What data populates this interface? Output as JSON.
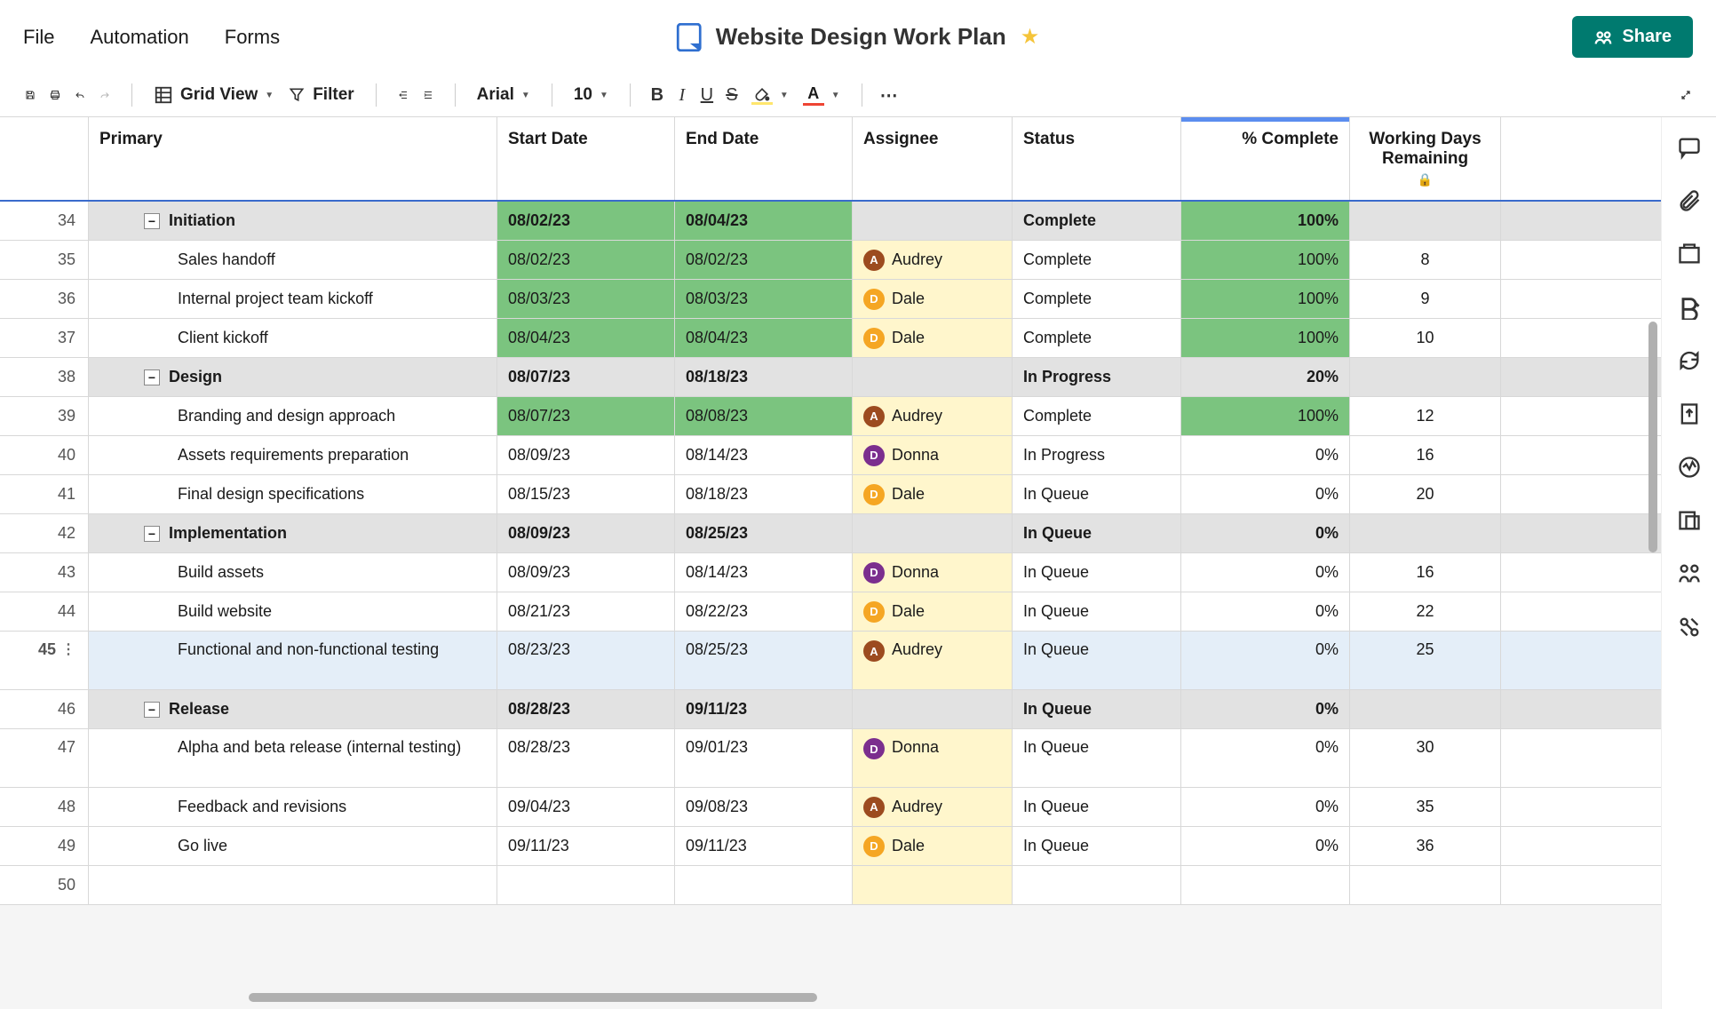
{
  "menu": {
    "file": "File",
    "automation": "Automation",
    "forms": "Forms"
  },
  "title": "Website Design Work Plan",
  "share_label": "Share",
  "toolbar": {
    "grid_view": "Grid View",
    "filter": "Filter",
    "font": "Arial",
    "font_size": "10"
  },
  "columns": {
    "primary": "Primary",
    "start": "Start Date",
    "end": "End Date",
    "assignee": "Assignee",
    "status": "Status",
    "percent": "% Complete",
    "days": "Working Days Remaining"
  },
  "assignees": {
    "audrey": {
      "initial": "A",
      "name": "Audrey",
      "color": "av-a"
    },
    "dale": {
      "initial": "D",
      "name": "Dale",
      "color": "av-d-orange"
    },
    "donna": {
      "initial": "D",
      "name": "Donna",
      "color": "av-d-purple"
    }
  },
  "rows": [
    {
      "num": "34",
      "type": "parent",
      "primary": "Initiation",
      "start": "08/02/23",
      "end": "08/04/23",
      "assignee": null,
      "status": "Complete",
      "percent": "100%",
      "days": "",
      "start_bg": "green",
      "end_bg": "green",
      "percent_bg": "green"
    },
    {
      "num": "35",
      "type": "child",
      "primary": "Sales handoff",
      "start": "08/02/23",
      "end": "08/02/23",
      "assignee": "audrey",
      "status": "Complete",
      "percent": "100%",
      "days": "8",
      "start_bg": "green",
      "end_bg": "green",
      "percent_bg": "green",
      "assignee_bg": "yellow"
    },
    {
      "num": "36",
      "type": "child",
      "primary": "Internal project team kickoff",
      "start": "08/03/23",
      "end": "08/03/23",
      "assignee": "dale",
      "status": "Complete",
      "percent": "100%",
      "days": "9",
      "start_bg": "green",
      "end_bg": "green",
      "percent_bg": "green",
      "assignee_bg": "yellow"
    },
    {
      "num": "37",
      "type": "child",
      "primary": "Client kickoff",
      "start": "08/04/23",
      "end": "08/04/23",
      "assignee": "dale",
      "status": "Complete",
      "percent": "100%",
      "days": "10",
      "start_bg": "green",
      "end_bg": "green",
      "percent_bg": "green",
      "assignee_bg": "yellow"
    },
    {
      "num": "38",
      "type": "parent",
      "primary": "Design",
      "start": "08/07/23",
      "end": "08/18/23",
      "assignee": null,
      "status": "In Progress",
      "percent": "20%",
      "days": ""
    },
    {
      "num": "39",
      "type": "child",
      "primary": "Branding and design approach",
      "start": "08/07/23",
      "end": "08/08/23",
      "assignee": "audrey",
      "status": "Complete",
      "percent": "100%",
      "days": "12",
      "start_bg": "green",
      "end_bg": "green",
      "percent_bg": "green",
      "assignee_bg": "yellow"
    },
    {
      "num": "40",
      "type": "child",
      "primary": "Assets requirements preparation",
      "start": "08/09/23",
      "end": "08/14/23",
      "assignee": "donna",
      "status": "In Progress",
      "percent": "0%",
      "days": "16",
      "assignee_bg": "yellow"
    },
    {
      "num": "41",
      "type": "child",
      "primary": "Final design specifications",
      "start": "08/15/23",
      "end": "08/18/23",
      "assignee": "dale",
      "status": "In Queue",
      "percent": "0%",
      "days": "20",
      "assignee_bg": "yellow"
    },
    {
      "num": "42",
      "type": "parent",
      "primary": "Implementation",
      "start": "08/09/23",
      "end": "08/25/23",
      "assignee": null,
      "status": "In Queue",
      "percent": "0%",
      "days": ""
    },
    {
      "num": "43",
      "type": "child",
      "primary": "Build assets",
      "start": "08/09/23",
      "end": "08/14/23",
      "assignee": "donna",
      "status": "In Queue",
      "percent": "0%",
      "days": "16",
      "assignee_bg": "yellow"
    },
    {
      "num": "44",
      "type": "child",
      "primary": "Build website",
      "start": "08/21/23",
      "end": "08/22/23",
      "assignee": "dale",
      "status": "In Queue",
      "percent": "0%",
      "days": "22",
      "assignee_bg": "yellow"
    },
    {
      "num": "45",
      "type": "child",
      "primary": "Functional and non-functional testing",
      "start": "08/23/23",
      "end": "08/25/23",
      "assignee": "audrey",
      "status": "In Queue",
      "percent": "0%",
      "days": "25",
      "assignee_bg": "yellow",
      "selected": true,
      "tall": true
    },
    {
      "num": "46",
      "type": "parent",
      "primary": "Release",
      "start": "08/28/23",
      "end": "09/11/23",
      "assignee": null,
      "status": "In Queue",
      "percent": "0%",
      "days": ""
    },
    {
      "num": "47",
      "type": "child",
      "primary": "Alpha and beta release (internal testing)",
      "start": "08/28/23",
      "end": "09/01/23",
      "assignee": "donna",
      "status": "In Queue",
      "percent": "0%",
      "days": "30",
      "assignee_bg": "yellow",
      "tall": true
    },
    {
      "num": "48",
      "type": "child",
      "primary": "Feedback and revisions",
      "start": "09/04/23",
      "end": "09/08/23",
      "assignee": "audrey",
      "status": "In Queue",
      "percent": "0%",
      "days": "35",
      "assignee_bg": "yellow"
    },
    {
      "num": "49",
      "type": "child",
      "primary": "Go live",
      "start": "09/11/23",
      "end": "09/11/23",
      "assignee": "dale",
      "status": "In Queue",
      "percent": "0%",
      "days": "36",
      "assignee_bg": "yellow"
    },
    {
      "num": "50",
      "type": "empty"
    }
  ]
}
